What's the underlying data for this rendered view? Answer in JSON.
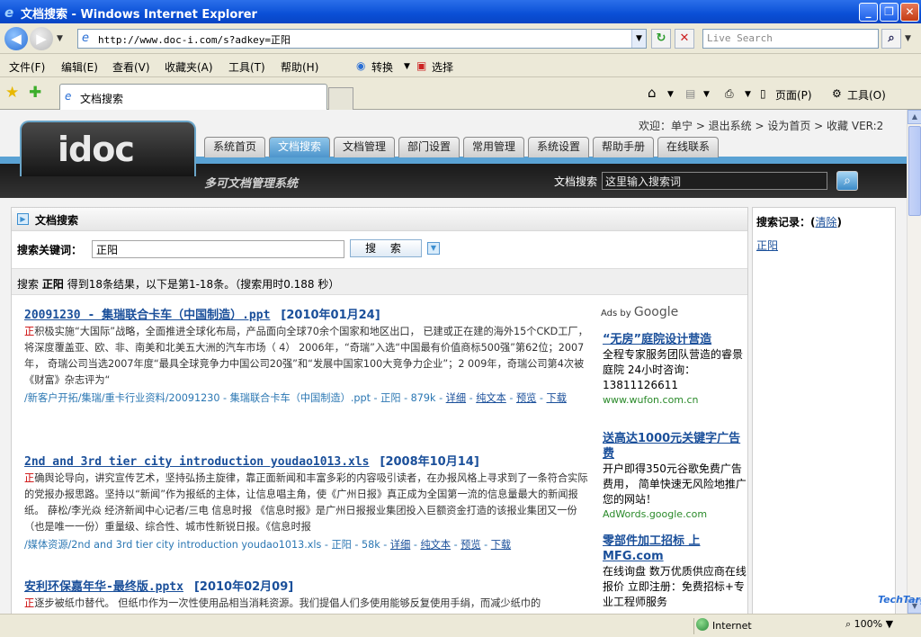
{
  "window": {
    "title": "文档搜索 - Windows Internet Explorer",
    "min": "_",
    "max": "❐",
    "close": "✕"
  },
  "address": {
    "url": "http://www.doc-i.com/s?adkey=正阳",
    "live_search_placeholder": "Live Search"
  },
  "menu": [
    "文件(F)",
    "编辑(E)",
    "查看(V)",
    "收藏夹(A)",
    "工具(T)",
    "帮助(H)"
  ],
  "toolbar": {
    "convert": "转换",
    "select": "选择",
    "page": "页面(P)",
    "tools": "工具(O)"
  },
  "tab": {
    "label": "文档搜索"
  },
  "site": {
    "logo": "idoc",
    "slogan": "多可文档管理系统",
    "top_links": "欢迎：单宁 > 退出系统 > 设为首页 > 收藏 VER:2",
    "nav": [
      "系统首页",
      "文档搜索",
      "文档管理",
      "部门设置",
      "常用管理",
      "系统设置",
      "帮助手册",
      "在线联系"
    ],
    "header_search_label": "文档搜索",
    "header_search_value": "这里输入搜索词"
  },
  "panel": {
    "title": "文档搜索",
    "keyword_label": "搜索关键词：",
    "keyword_value": "正阳",
    "search_button": "搜 索",
    "summary_prefix": "搜索",
    "summary_keyword": "正阳",
    "summary_rest": "得到18条结果，以下是第1-18条。（搜索用时0.188 秒）"
  },
  "results": [
    {
      "title": "20091230 - 集瑞联合卡车（中国制造）.ppt",
      "date": "[2010年01月24]",
      "snippet_hl": "正",
      "snippet": "积极实施“大国际”战略，全面推进全球化布局，产品面向全球70余个国家和地区出口， 已建或正在建的海外15个CKD工厂，将深度覆盖亚、欧、非、南美和北美五大洲的汽车市场（ 4） 2006年，“奇瑞”入选“中国最有价值商标500强”第62位；2007年， 奇瑞公司当选2007年度“最具全球竞争力中国公司20强”和“发展中国家100大竞争力企业”；2 009年，奇瑞公司第4次被《财富》杂志评为“",
      "path": "/新客户开拓/集瑞/重卡行业资料/20091230 - 集瑞联合卡车（中国制造）.ppt - 正阳 - 879k - ",
      "links": [
        "详细",
        "纯文本",
        "预览",
        "下载"
      ]
    },
    {
      "title": "2nd and 3rd tier city introduction youdao1013.xls",
      "date": "[2008年10月14]",
      "snippet_hl": "正",
      "snippet": "确舆论导向，讲究宣传艺术，坚持弘扬主旋律，靠正面新闻和丰富多彩的内容吸引读者，在办报风格上寻求到了一条符合实际的党报办报思路。坚持以“新闻”作为报纸的主体，让信息唱主角，使《广州日报》真正成为全国第一流的信息量最大的新闻报纸。 薛松/李光焱 经济新闻中心记者/三电 信息时报 《信息时报》是广州日报报业集团投入巨额资金打造的该报业集团又一份（也是唯一一份）重量级、综合性、城市性新锐日报。《信息时报",
      "path": "/媒体资源/2nd and 3rd tier city introduction youdao1013.xls - 正阳 - 58k - ",
      "links": [
        "详细",
        "纯文本",
        "预览",
        "下载"
      ]
    },
    {
      "title": "安利环保嘉年华-最终版.pptx",
      "date": "[2010年02月09]",
      "snippet_hl": "正",
      "snippet": "逐步被纸巾替代。 但纸巾作为一次性使用品相当消耗资源。我们提倡人们多使用能够反复使用手绢，而减少纸巾的"
    }
  ],
  "ads": {
    "label": "Ads by",
    "brand": "Google",
    "items": [
      {
        "title": "“无房”庭院设计营造",
        "desc": "全程专家服务团队营造的睿景庭院 24小时咨询：13811126611",
        "url": "www.wufon.com.cn"
      },
      {
        "title": "送高达1000元关键字广告费",
        "desc": "开户即得350元谷歌免费广告费用， 简单快速无风险地推广您的网站！",
        "url": "AdWords.google.com"
      },
      {
        "title": "零部件加工招标 上MFG.com",
        "desc": "在线询盘 数万优质供应商在线报价 立即注册：免费招标+专业工程师服务",
        "url": ""
      }
    ]
  },
  "side": {
    "title": "搜索记录：",
    "clear": "清除",
    "record": "正阳"
  },
  "status": {
    "zone": "Internet",
    "zoom": "100%"
  },
  "watermark": "TechTarget"
}
